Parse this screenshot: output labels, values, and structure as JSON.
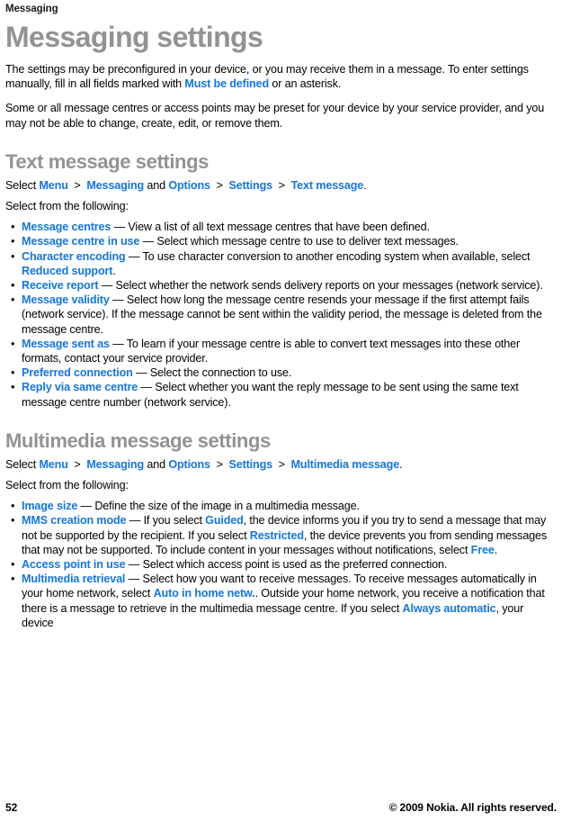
{
  "running_header": "Messaging",
  "title": "Messaging settings",
  "intro": {
    "para1_a": "The settings may be preconfigured in your device, or you may receive them in a message. To enter settings manually, fill in all fields marked with ",
    "para1_kw": "Must be defined",
    "para1_b": " or an asterisk.",
    "para2": "Some or all message centres or access points may be preset for your device by your service provider, and you may not be able to change, create, edit, or remove them."
  },
  "colors": {
    "keyword_blue": "#1476e2",
    "heading_gray": "#939393",
    "body_black": "#000000"
  },
  "sections": [
    {
      "heading": "Text message settings",
      "path": {
        "prefix": "Select ",
        "items": [
          "Menu",
          "Messaging",
          "Options",
          "Settings",
          "Text message"
        ],
        "joiner_gt": ">",
        "joiner_and": "and",
        "suffix": "."
      },
      "lead": "Select from the following:",
      "bullets": [
        {
          "term": "Message centres",
          "parts": [
            {
              "type": "text",
              "value": " — View a list of all text message centres that have been defined."
            }
          ]
        },
        {
          "term": "Message centre in use",
          "parts": [
            {
              "type": "text",
              "value": " — Select which message centre to use to deliver text messages."
            }
          ]
        },
        {
          "term": "Character encoding",
          "parts": [
            {
              "type": "text",
              "value": " — To use character conversion to another encoding system when available, select "
            },
            {
              "type": "kw",
              "value": "Reduced support"
            },
            {
              "type": "text",
              "value": "."
            }
          ]
        },
        {
          "term": "Receive report",
          "parts": [
            {
              "type": "text",
              "value": " — Select whether the network sends delivery reports on your messages (network service)."
            }
          ]
        },
        {
          "term": "Message validity",
          "parts": [
            {
              "type": "text",
              "value": " — Select how long the message centre resends your message if the first attempt fails (network service). If the message cannot be sent within the validity period, the message is deleted from the message centre."
            }
          ]
        },
        {
          "term": "Message sent as",
          "parts": [
            {
              "type": "text",
              "value": " — To learn if your message centre is able to convert text messages into these other formats, contact your service provider."
            }
          ]
        },
        {
          "term": "Preferred connection",
          "parts": [
            {
              "type": "text",
              "value": " — Select the connection to use."
            }
          ]
        },
        {
          "term": "Reply via same centre",
          "parts": [
            {
              "type": "text",
              "value": " — Select whether you want the reply message to be sent using the same text message centre number (network service)."
            }
          ]
        }
      ]
    },
    {
      "heading": "Multimedia message settings",
      "path": {
        "prefix": "Select ",
        "items": [
          "Menu",
          "Messaging",
          "Options",
          "Settings",
          "Multimedia message"
        ],
        "joiner_gt": ">",
        "joiner_and": "and",
        "suffix": "."
      },
      "lead": "Select from the following:",
      "bullets": [
        {
          "term": "Image size",
          "parts": [
            {
              "type": "text",
              "value": " — Define the size of the image in a multimedia message."
            }
          ]
        },
        {
          "term": "MMS creation mode",
          "parts": [
            {
              "type": "text",
              "value": " — If you select "
            },
            {
              "type": "kw",
              "value": "Guided"
            },
            {
              "type": "text",
              "value": ", the device informs you if you try to send a message that may not be supported by the recipient. If you select "
            },
            {
              "type": "kw",
              "value": "Restricted"
            },
            {
              "type": "text",
              "value": ", the device prevents you from sending messages that may not be supported. To include content in your messages without notifications, select "
            },
            {
              "type": "kw",
              "value": "Free"
            },
            {
              "type": "text",
              "value": "."
            }
          ]
        },
        {
          "term": "Access point in use",
          "parts": [
            {
              "type": "text",
              "value": " — Select which access point is used as the preferred connection."
            }
          ]
        },
        {
          "term": "Multimedia retrieval",
          "parts": [
            {
              "type": "text",
              "value": " — Select how you want to receive messages. To receive messages automatically in your home network, select "
            },
            {
              "type": "kw",
              "value": "Auto in home netw."
            },
            {
              "type": "text",
              "value": ". Outside your home network, you receive a notification that there is a message to retrieve in the multimedia message centre. If you select "
            },
            {
              "type": "kw",
              "value": "Always automatic"
            },
            {
              "type": "text",
              "value": ", your device"
            }
          ]
        }
      ]
    }
  ],
  "footer": {
    "page_number": "52",
    "copyright": "© 2009 Nokia. All rights reserved."
  }
}
